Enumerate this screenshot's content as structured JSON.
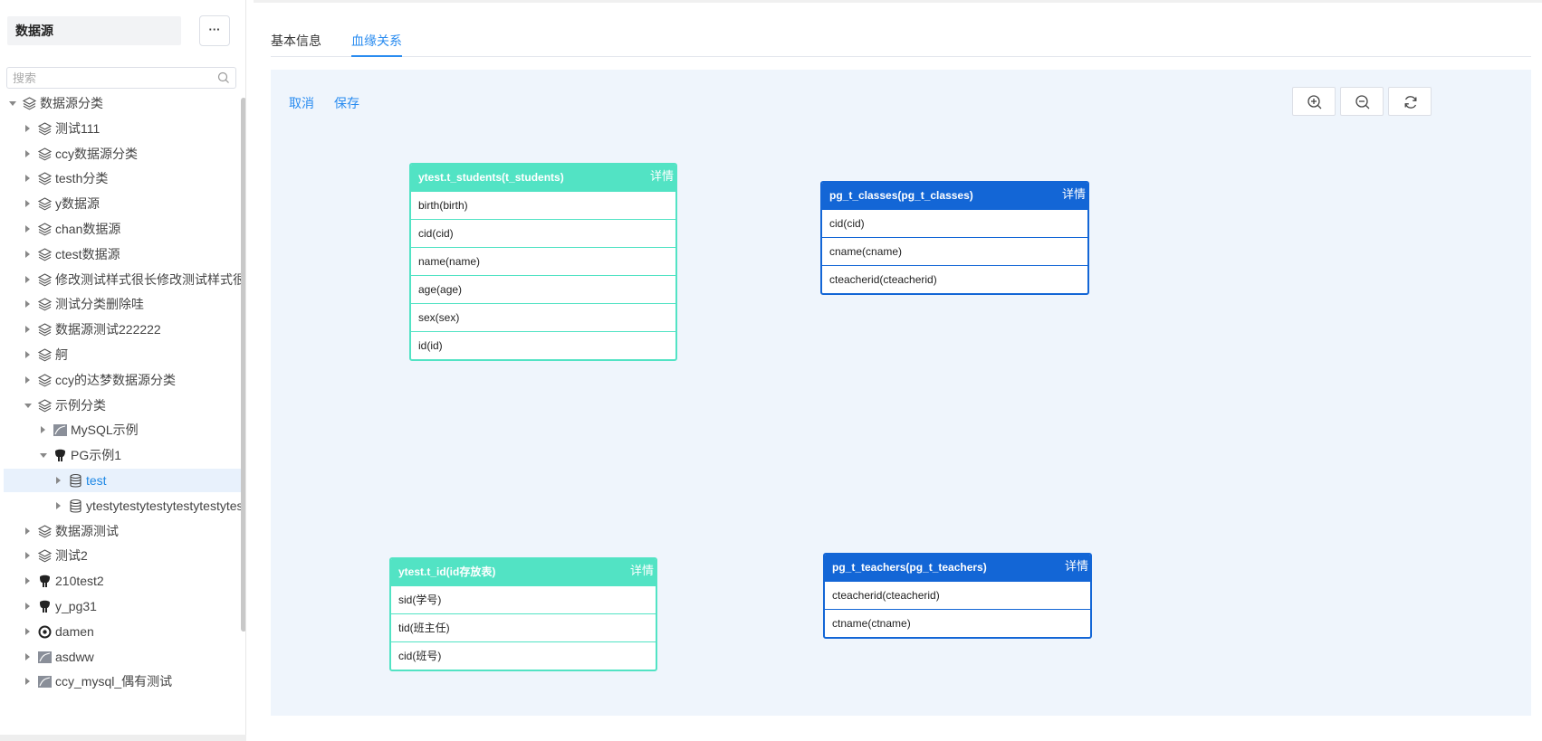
{
  "sidebar": {
    "title": "数据源",
    "more_label": "···",
    "search_placeholder": "搜索",
    "tree": [
      {
        "label": "数据源分类",
        "level": 0,
        "expanded": true,
        "icon": "layers-icon"
      },
      {
        "label": "测试111",
        "level": 1,
        "icon": "layers-icon"
      },
      {
        "label": "ccy数据源分类",
        "level": 1,
        "icon": "layers-icon"
      },
      {
        "label": "testh分类",
        "level": 1,
        "icon": "layers-icon"
      },
      {
        "label": "y数据源",
        "level": 1,
        "icon": "layers-icon"
      },
      {
        "label": "chan数据源",
        "level": 1,
        "icon": "layers-icon"
      },
      {
        "label": "ctest数据源",
        "level": 1,
        "icon": "layers-icon"
      },
      {
        "label": "修改测试样式很长修改测试样式很长",
        "level": 1,
        "icon": "layers-icon"
      },
      {
        "label": "测试分类删除哇",
        "level": 1,
        "icon": "layers-icon"
      },
      {
        "label": "数据源测试222222",
        "level": 1,
        "icon": "layers-icon"
      },
      {
        "label": "舸",
        "level": 1,
        "icon": "layers-icon"
      },
      {
        "label": "ccy的达梦数据源分类",
        "level": 1,
        "icon": "layers-icon"
      },
      {
        "label": "示例分类",
        "level": 1,
        "expanded": true,
        "icon": "layers-icon"
      },
      {
        "label": "MySQL示例",
        "level": 2,
        "icon": "mysql-icon"
      },
      {
        "label": "PG示例1",
        "level": 2,
        "expanded": true,
        "icon": "postgres-icon"
      },
      {
        "label": "test",
        "level": 3,
        "icon": "database-icon",
        "selected": true
      },
      {
        "label": "ytestytestytestytestytestytest",
        "level": 3,
        "icon": "database-icon"
      },
      {
        "label": "数据源测试",
        "level": 1,
        "icon": "layers-icon"
      },
      {
        "label": "测试2",
        "level": 1,
        "icon": "layers-icon"
      },
      {
        "label": "210test2",
        "level": 1,
        "icon": "postgres-icon"
      },
      {
        "label": "y_pg31",
        "level": 1,
        "icon": "postgres-icon"
      },
      {
        "label": "damen",
        "level": 1,
        "icon": "dameng-icon"
      },
      {
        "label": "asdww",
        "level": 1,
        "icon": "mysql-icon"
      },
      {
        "label": "ccy_mysql_偶有测试",
        "level": 1,
        "icon": "mysql-icon"
      }
    ]
  },
  "tabs": [
    {
      "label": "基本信息",
      "active": false
    },
    {
      "label": "血缘关系",
      "active": true
    }
  ],
  "actions": {
    "cancel": "取消",
    "save": "保存"
  },
  "zoom_tools": [
    "zoom-in-icon",
    "zoom-out-icon",
    "refresh-icon"
  ],
  "entities": [
    {
      "title": "ytest.t_students(t_students)",
      "detail": "详情",
      "color": "#52e3c4",
      "fields": [
        "birth(birth)",
        "cid(cid)",
        "name(name)",
        "age(age)",
        "sex(sex)",
        "id(id)"
      ]
    },
    {
      "title": "pg_t_classes(pg_t_classes)",
      "detail": "详情",
      "color": "#1366d6",
      "fields": [
        "cid(cid)",
        "cname(cname)",
        "cteacherid(cteacherid)"
      ]
    },
    {
      "title": "ytest.t_id(id存放表)",
      "detail": "详情",
      "color": "#52e3c4",
      "fields": [
        "sid(学号)",
        "tid(班主任)",
        "cid(班号)"
      ]
    },
    {
      "title": "pg_t_teachers(pg_t_teachers)",
      "detail": "详情",
      "color": "#1366d6",
      "fields": [
        "cteacherid(cteacherid)",
        "ctname(ctname)"
      ]
    }
  ]
}
